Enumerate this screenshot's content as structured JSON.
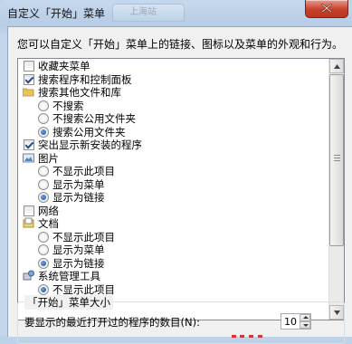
{
  "window": {
    "title": "自定义「开始」菜单",
    "ghost_tab_label": "上海站"
  },
  "description": "您可以自定义「开始」菜单上的链接、图标以及菜单的外观和行为。",
  "items": [
    {
      "kind": "checkbox",
      "label": "收藏夹菜单",
      "checked": false,
      "indent": 0
    },
    {
      "kind": "checkbox",
      "label": "搜索程序和控制面板",
      "checked": true,
      "indent": 0
    },
    {
      "kind": "folder-icon",
      "label": "搜索其他文件和库",
      "icon": "folder-icon",
      "indent": 0
    },
    {
      "kind": "radio",
      "label": "不搜索",
      "checked": false,
      "indent": 1
    },
    {
      "kind": "radio",
      "label": "不搜索公用文件夹",
      "checked": false,
      "indent": 1
    },
    {
      "kind": "radio",
      "label": "搜索公用文件夹",
      "checked": true,
      "indent": 1
    },
    {
      "kind": "checkbox",
      "label": "突出显示新安装的程序",
      "checked": true,
      "indent": 0
    },
    {
      "kind": "pictures-icon",
      "label": "图片",
      "icon": "pictures-icon",
      "indent": 0
    },
    {
      "kind": "radio",
      "label": "不显示此项目",
      "checked": false,
      "indent": 1
    },
    {
      "kind": "radio",
      "label": "显示为菜单",
      "checked": false,
      "indent": 1
    },
    {
      "kind": "radio",
      "label": "显示为链接",
      "checked": true,
      "indent": 1
    },
    {
      "kind": "checkbox",
      "label": "网络",
      "checked": false,
      "indent": 0
    },
    {
      "kind": "documents-icon",
      "label": "文档",
      "icon": "documents-icon",
      "indent": 0
    },
    {
      "kind": "radio",
      "label": "不显示此项目",
      "checked": false,
      "indent": 1
    },
    {
      "kind": "radio",
      "label": "显示为菜单",
      "checked": false,
      "indent": 1
    },
    {
      "kind": "radio",
      "label": "显示为链接",
      "checked": true,
      "indent": 1
    },
    {
      "kind": "admin-tools-icon",
      "label": "系统管理工具",
      "icon": "admin-tools-icon",
      "indent": 0
    },
    {
      "kind": "radio",
      "label": "不显示此项目",
      "checked": true,
      "indent": 1
    }
  ],
  "size_group": {
    "title": "「开始」菜单大小",
    "recent_programs_label": "要显示的最近打开过的程序的数目(N):",
    "recent_programs_value": "10"
  },
  "colors": {
    "accent_red": "#c7412a",
    "radio_fill": "#1c4fa0"
  }
}
